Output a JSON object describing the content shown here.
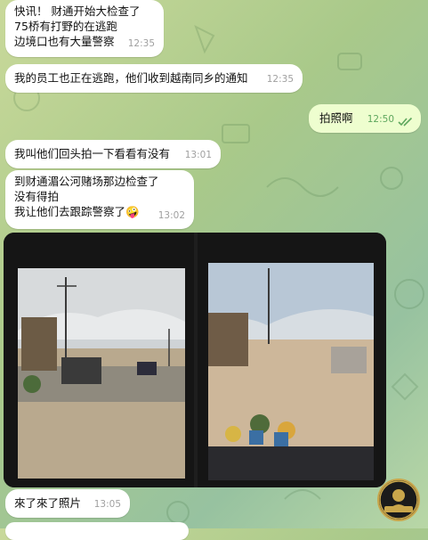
{
  "messages": [
    {
      "text": "快讯！ 财通开始大检查了\n75桥有打野的在逃跑\n边境口也有大量警察",
      "time": "12:35"
    },
    {
      "text": "我的员工也正在逃跑，他们收到越南同乡的通知",
      "time": "12:35"
    },
    {
      "text": "拍照啊",
      "time": "12:50",
      "status": "read-double-check"
    },
    {
      "text": "我叫他们回头拍一下看看有没有",
      "time": "13:01"
    },
    {
      "text": "到财通湄公河赌场那边检查了\n没有得拍\n我让他们去跟踪警察了🤪",
      "time": "13:02"
    },
    {
      "text": "來了來了照片",
      "time": "13:05"
    }
  ],
  "photos": [
    {
      "name": "photo-street-left"
    },
    {
      "name": "photo-street-right"
    }
  ],
  "logo": {
    "text": "頭條有新聞"
  },
  "colors": {
    "incoming_bubble": "#ffffff",
    "outgoing_bubble": "#eefecf",
    "outgoing_time": "#5ea75e",
    "incoming_time": "#a0a0a0"
  }
}
